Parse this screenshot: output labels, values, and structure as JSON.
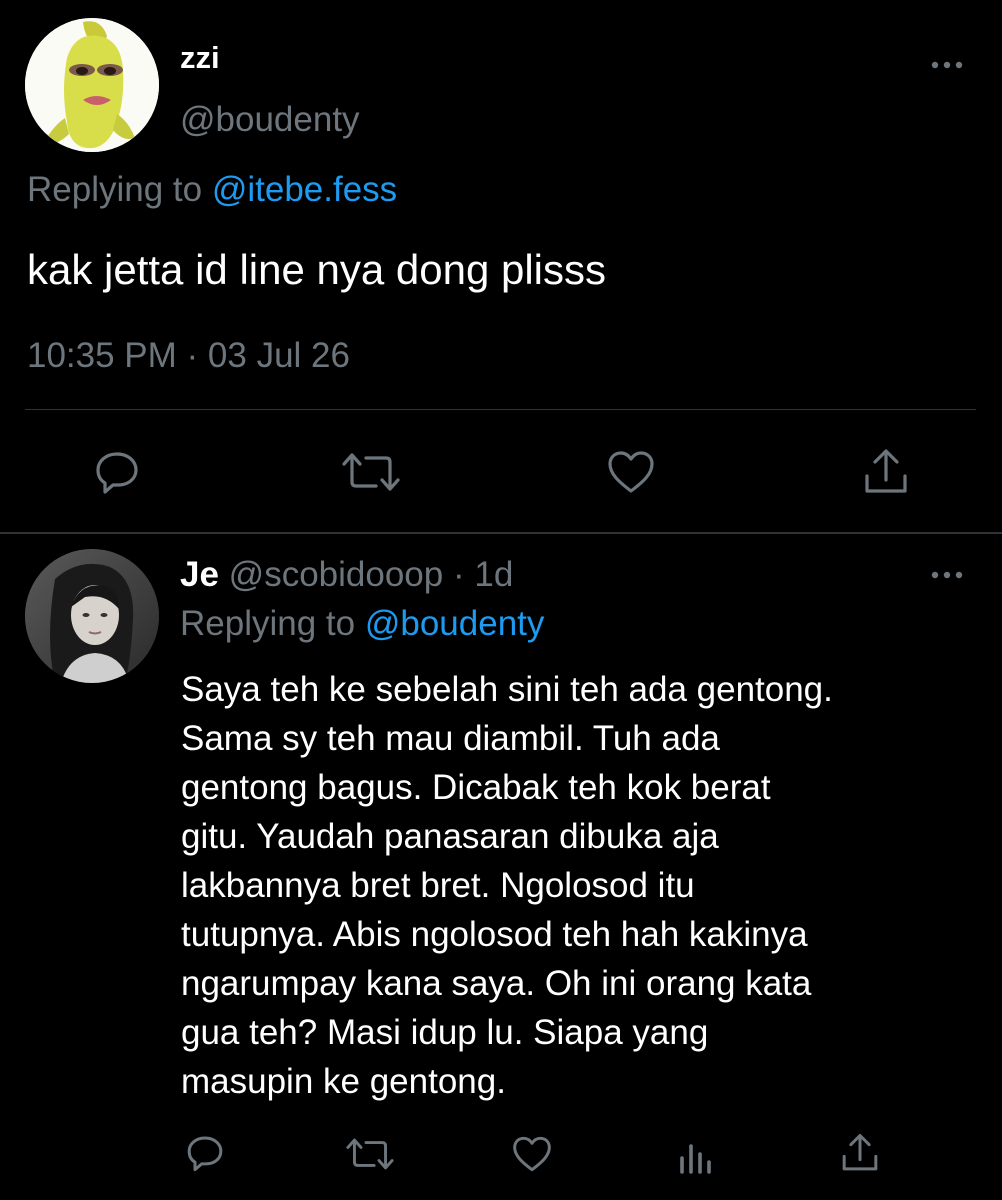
{
  "main_tweet": {
    "display_name": "zzi",
    "handle": "@boudenty",
    "replying_label": "Replying to",
    "replying_to": "@itebe.fess",
    "text": "kak jetta id line nya dong plisss",
    "timestamp": "10:35 PM · 03 Jul 26",
    "actions": [
      "reply-icon",
      "retweet-icon",
      "like-icon",
      "share-icon"
    ]
  },
  "reply_tweet": {
    "display_name": "Je",
    "handle": "@scobidooop",
    "dot": "·",
    "age": "1d",
    "replying_label": "Replying to",
    "replying_to": "@boudenty",
    "text": "Saya teh ke sebelah sini teh ada gentong.\nSama sy teh mau diambil. Tuh ada\ngentong bagus. Dicabak teh kok berat\ngitu. Yaudah panasaran dibuka aja\nlakbannya bret bret. Ngolosod itu\ntutupnya. Abis ngolosod teh hah kakinya\nngarumpay kana saya. Oh ini orang kata\ngua teh? Masi idup lu. Siapa yang\nmasupin ke gentong.",
    "actions": [
      "reply-icon",
      "retweet-icon",
      "like-icon",
      "analytics-icon",
      "share-icon"
    ]
  },
  "colors": {
    "background": "#000000",
    "primary_text": "#ffffff",
    "secondary_text": "#6e767d",
    "accent": "#1d9bf0",
    "divider": "#2f3336"
  }
}
